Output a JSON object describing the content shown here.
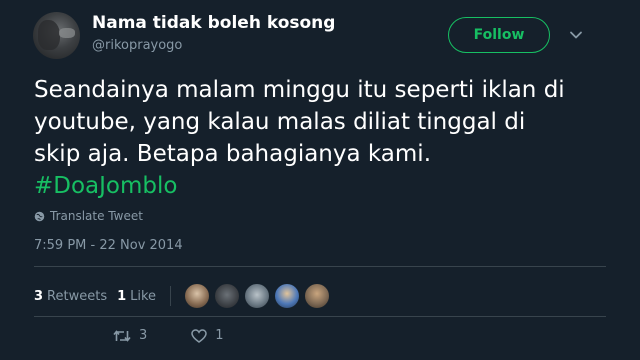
{
  "author": {
    "display_name": "Nama tidak boleh kosong",
    "username": "@rikoprayogo",
    "avatar_icon": "profile-photo"
  },
  "header": {
    "follow_label": "Follow",
    "menu_icon": "chevron-down-icon"
  },
  "tweet": {
    "lines": [
      "Seandainya malam minggu itu seperti iklan di",
      "youtube, yang kalau malas diliat tinggal di",
      "skip aja. Betapa bahagianya kami."
    ],
    "hashtag": "#DoaJomblo",
    "translate_label": "Translate Tweet",
    "timestamp": "7:59 PM - 22 Nov 2014"
  },
  "stats": {
    "retweets_count": "3",
    "retweets_label": "Retweets",
    "likes_count": "1",
    "likes_label": "Like",
    "liker_faces": [
      "face-1",
      "face-2",
      "face-3",
      "face-4",
      "face-5"
    ]
  },
  "actions": {
    "reply_icon": "reply-icon",
    "retweet_count": "3",
    "like_count": "1"
  },
  "colors": {
    "background": "#15202b",
    "accent_green": "#17bf63",
    "muted": "#8899a6",
    "divider": "#38444d"
  }
}
